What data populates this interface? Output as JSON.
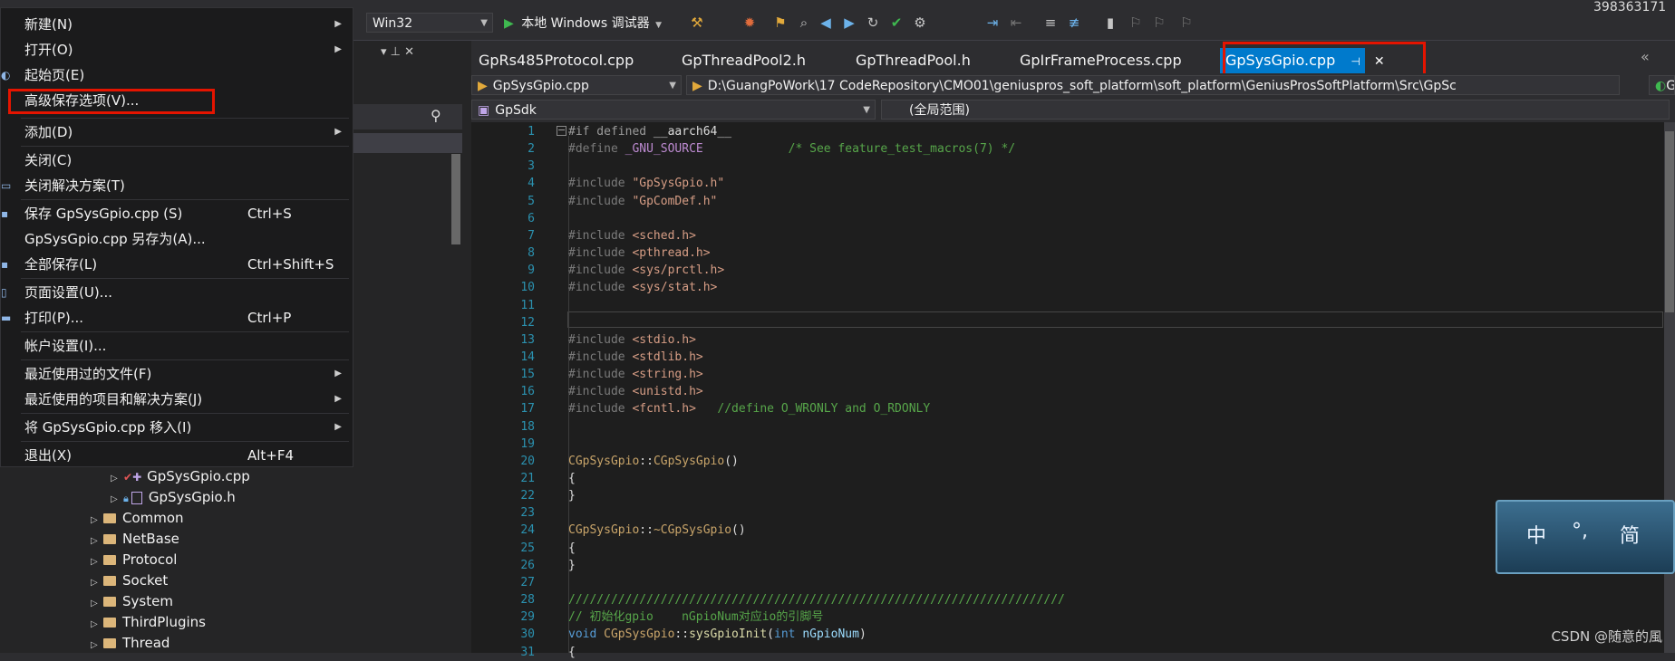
{
  "toolbar": {
    "platform": "Win32",
    "debugger_label": "本地 Windows 调试器",
    "right_number": "398363171"
  },
  "file_menu": {
    "items": [
      {
        "label": "新建(N)",
        "shortcut": "",
        "submenu": true
      },
      {
        "label": "打开(O)",
        "shortcut": "",
        "submenu": true
      },
      {
        "label": "起始页(E)",
        "shortcut": "",
        "submenu": false
      },
      {
        "label": "高级保存选项(V)...",
        "shortcut": "",
        "submenu": false
      },
      {
        "label": "添加(D)",
        "shortcut": "",
        "submenu": true
      },
      {
        "label": "关闭(C)",
        "shortcut": "",
        "submenu": false
      },
      {
        "label": "关闭解决方案(T)",
        "shortcut": "",
        "submenu": false
      },
      {
        "label": "保存 GpSysGpio.cpp (S)",
        "shortcut": "Ctrl+S",
        "submenu": false
      },
      {
        "label": "GpSysGpio.cpp 另存为(A)...",
        "shortcut": "",
        "submenu": false
      },
      {
        "label": "全部保存(L)",
        "shortcut": "Ctrl+Shift+S",
        "submenu": false
      },
      {
        "label": "页面设置(U)...",
        "shortcut": "",
        "submenu": false
      },
      {
        "label": "打印(P)...",
        "shortcut": "Ctrl+P",
        "submenu": false
      },
      {
        "label": "帐户设置(I)...",
        "shortcut": "",
        "submenu": false
      },
      {
        "label": "最近使用过的文件(F)",
        "shortcut": "",
        "submenu": true
      },
      {
        "label": "最近使用的项目和解决方案(J)",
        "shortcut": "",
        "submenu": true
      },
      {
        "label": "将 GpSysGpio.cpp 移入(I)",
        "shortcut": "",
        "submenu": true
      },
      {
        "label": "退出(X)",
        "shortcut": "Alt+F4",
        "submenu": false
      }
    ]
  },
  "solution_tree": {
    "files": [
      "GpSysGpio.cpp",
      "GpSysGpio.h"
    ],
    "folders": [
      "Common",
      "NetBase",
      "Protocol",
      "Socket",
      "System",
      "ThirdPlugins",
      "Thread"
    ]
  },
  "tabs": [
    {
      "label": "GpRs485Protocol.cpp",
      "active": false
    },
    {
      "label": "GpThreadPool2.h",
      "active": false
    },
    {
      "label": "GpThreadPool.h",
      "active": false
    },
    {
      "label": "GpIrFrameProcess.cpp",
      "active": false
    },
    {
      "label": "GpSysGpio.cpp",
      "active": true
    }
  ],
  "navbar": {
    "file": "GpSysGpio.cpp",
    "path": "D:\\GuangPoWork\\17 CodeRepository\\CMO01\\geniuspros_soft_platform\\soft_platform\\GeniusProsSoftPlatform\\Src\\GpSc",
    "path_right": "G",
    "project": "GpSdk",
    "scope": "(全局范围)"
  },
  "code_lines": [
    {
      "n": "1",
      "text": "#if defined __aarch64__"
    },
    {
      "n": "2",
      "text": "#define _GNU_SOURCE            /* See feature_test_macros(7) */"
    },
    {
      "n": "3",
      "text": ""
    },
    {
      "n": "4",
      "text": "#include \"GpSysGpio.h\""
    },
    {
      "n": "5",
      "text": "#include \"GpComDef.h\""
    },
    {
      "n": "6",
      "text": ""
    },
    {
      "n": "7",
      "text": "#include <sched.h>"
    },
    {
      "n": "8",
      "text": "#include <pthread.h>"
    },
    {
      "n": "9",
      "text": "#include <sys/prctl.h>"
    },
    {
      "n": "10",
      "text": "#include <sys/stat.h>"
    },
    {
      "n": "11",
      "text": ""
    },
    {
      "n": "12",
      "text": ""
    },
    {
      "n": "13",
      "text": "#include <stdio.h>"
    },
    {
      "n": "14",
      "text": "#include <stdlib.h>"
    },
    {
      "n": "15",
      "text": "#include <string.h>"
    },
    {
      "n": "16",
      "text": "#include <unistd.h>"
    },
    {
      "n": "17",
      "text": "#include <fcntl.h>   //define O_WRONLY and O_RDONLY"
    },
    {
      "n": "18",
      "text": ""
    },
    {
      "n": "19",
      "text": ""
    },
    {
      "n": "20",
      "text": "CGpSysGpio::CGpSysGpio()"
    },
    {
      "n": "21",
      "text": "{"
    },
    {
      "n": "22",
      "text": "}"
    },
    {
      "n": "23",
      "text": ""
    },
    {
      "n": "24",
      "text": "CGpSysGpio::~CGpSysGpio()"
    },
    {
      "n": "25",
      "text": "{"
    },
    {
      "n": "26",
      "text": "}"
    },
    {
      "n": "27",
      "text": ""
    },
    {
      "n": "28",
      "text": "//////////////////////////////////////////////////////////////////////"
    },
    {
      "n": "29",
      "text": "// 初始化gpio    nGpioNum对应io的引脚号"
    },
    {
      "n": "30",
      "text": "void CGpSysGpio::sysGpioInit(int nGpioNum)"
    },
    {
      "n": "31",
      "text": "{"
    }
  ],
  "ime": {
    "a": "中",
    "b": "°,",
    "c": "简"
  },
  "watermark": "CSDN @随意的風",
  "colors": {
    "accent": "#007acc",
    "highlight_box": "#e51400"
  }
}
